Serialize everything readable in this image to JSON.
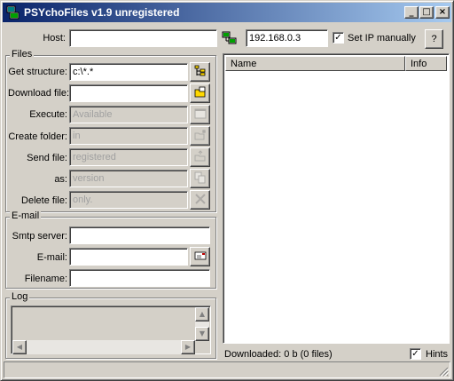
{
  "window": {
    "title": "PSYchoFiles v1.9 unregistered",
    "minimize": "_",
    "maximize": "□",
    "close": "×"
  },
  "host": {
    "label": "Host:",
    "value": "",
    "ip_value": "192.168.0.3",
    "set_ip_label": "Set IP manually",
    "set_ip_checked": true,
    "help_label": "?"
  },
  "files": {
    "group_title": "Files",
    "rows": [
      {
        "label": "Get structure:",
        "value": "c:\\*.*",
        "enabled": true,
        "icon": "tree-structure-icon"
      },
      {
        "label": "Download file:",
        "value": "",
        "enabled": true,
        "icon": "folder-download-icon"
      },
      {
        "label": "Execute:",
        "value": "Available",
        "enabled": false,
        "icon": "execute-window-icon"
      },
      {
        "label": "Create folder:",
        "value": "in",
        "enabled": false,
        "icon": "new-folder-icon"
      },
      {
        "label": "Send file:",
        "value": "registered",
        "enabled": false,
        "icon": "send-file-icon"
      },
      {
        "label": "as:",
        "value": "version",
        "enabled": false,
        "icon": "copy-files-icon"
      },
      {
        "label": "Delete file:",
        "value": "only.",
        "enabled": false,
        "icon": "delete-x-icon"
      }
    ]
  },
  "email": {
    "group_title": "E-mail",
    "smtp_label": "Smtp server:",
    "smtp_value": "",
    "email_label": "E-mail:",
    "email_value": "",
    "filename_label": "Filename:",
    "filename_value": ""
  },
  "log": {
    "group_title": "Log",
    "text": ""
  },
  "file_list": {
    "columns": [
      "Name",
      "Info"
    ],
    "rows": []
  },
  "status": {
    "downloaded": "Downloaded: 0 b (0 files)",
    "hints_label": "Hints",
    "hints_checked": true,
    "status_text": ""
  },
  "colors": {
    "face": "#d4d0c8",
    "title_start": "#0a246a",
    "title_end": "#a6caf0"
  }
}
